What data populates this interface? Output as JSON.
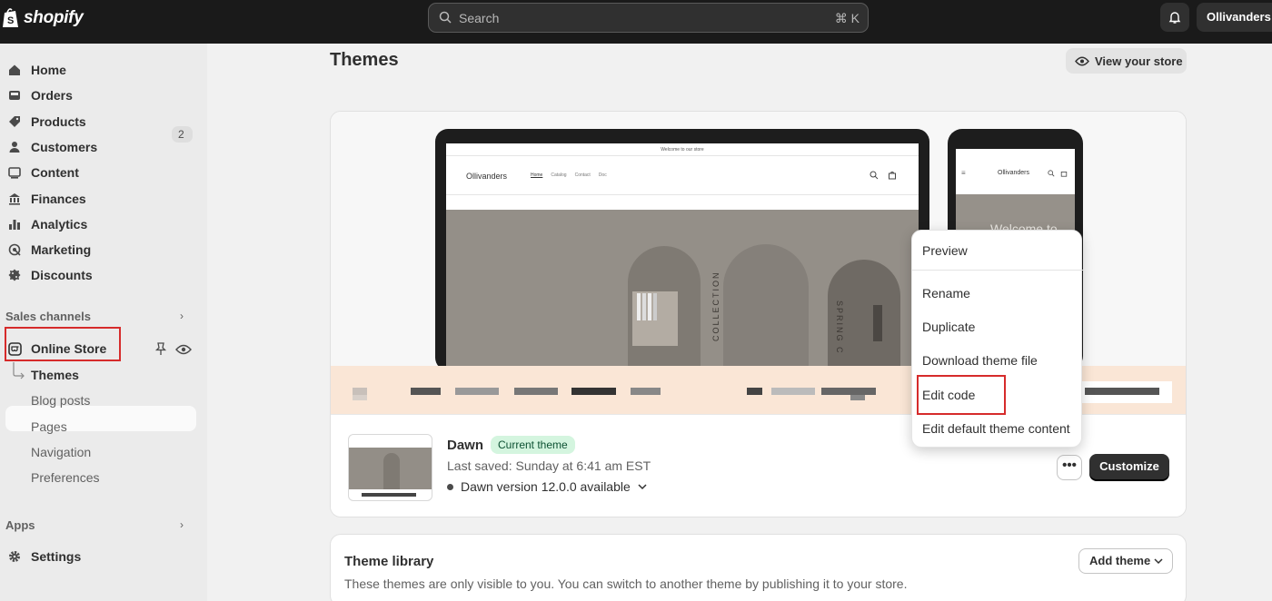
{
  "topbar": {
    "logo_text": "shopify",
    "search_placeholder": "Search",
    "search_shortcut": "⌘ K",
    "store_name": "Ollivanders"
  },
  "sidebar": {
    "items": [
      {
        "label": "Home",
        "icon": "home-icon"
      },
      {
        "label": "Orders",
        "icon": "orders-icon",
        "badge": "2"
      },
      {
        "label": "Products",
        "icon": "tag-icon"
      },
      {
        "label": "Customers",
        "icon": "person-icon"
      },
      {
        "label": "Content",
        "icon": "content-icon"
      },
      {
        "label": "Finances",
        "icon": "bank-icon"
      },
      {
        "label": "Analytics",
        "icon": "bar-chart-icon"
      },
      {
        "label": "Marketing",
        "icon": "target-icon"
      },
      {
        "label": "Discounts",
        "icon": "discount-icon"
      }
    ],
    "sales_channels_label": "Sales channels",
    "online_store_label": "Online Store",
    "sub_items": [
      "Themes",
      "Blog posts",
      "Pages",
      "Navigation",
      "Preferences"
    ],
    "apps_label": "Apps",
    "settings_label": "Settings"
  },
  "main": {
    "title": "Themes",
    "view_store_label": "View your store"
  },
  "preview": {
    "laptop_welcome": "Welcome to our store",
    "store_name": "Ollivanders",
    "laptop_links": [
      "Home",
      "Catalog",
      "Contact",
      "Doc"
    ],
    "phone_hero_text": "Welcome to",
    "hero_text_1": "COLLECTION",
    "hero_text_2": "SPRING C"
  },
  "current_theme": {
    "name": "Dawn",
    "badge": "Current theme",
    "last_saved": "Last saved: Sunday at 6:41 am EST",
    "version": "Dawn version 12.0.0 available",
    "more_label": "•••",
    "customize_label": "Customize"
  },
  "menu": {
    "items": [
      "Preview",
      "Rename",
      "Duplicate",
      "Download theme file",
      "Edit code",
      "Edit default theme content"
    ]
  },
  "library": {
    "title": "Theme library",
    "description": "These themes are only visible to you. You can switch to another theme by publishing it to your store.",
    "add_label": "Add theme"
  },
  "colors": {
    "topbar": "#1a1a1a",
    "highlight": "#d62b2b",
    "badge_green": "#d4f5df"
  }
}
